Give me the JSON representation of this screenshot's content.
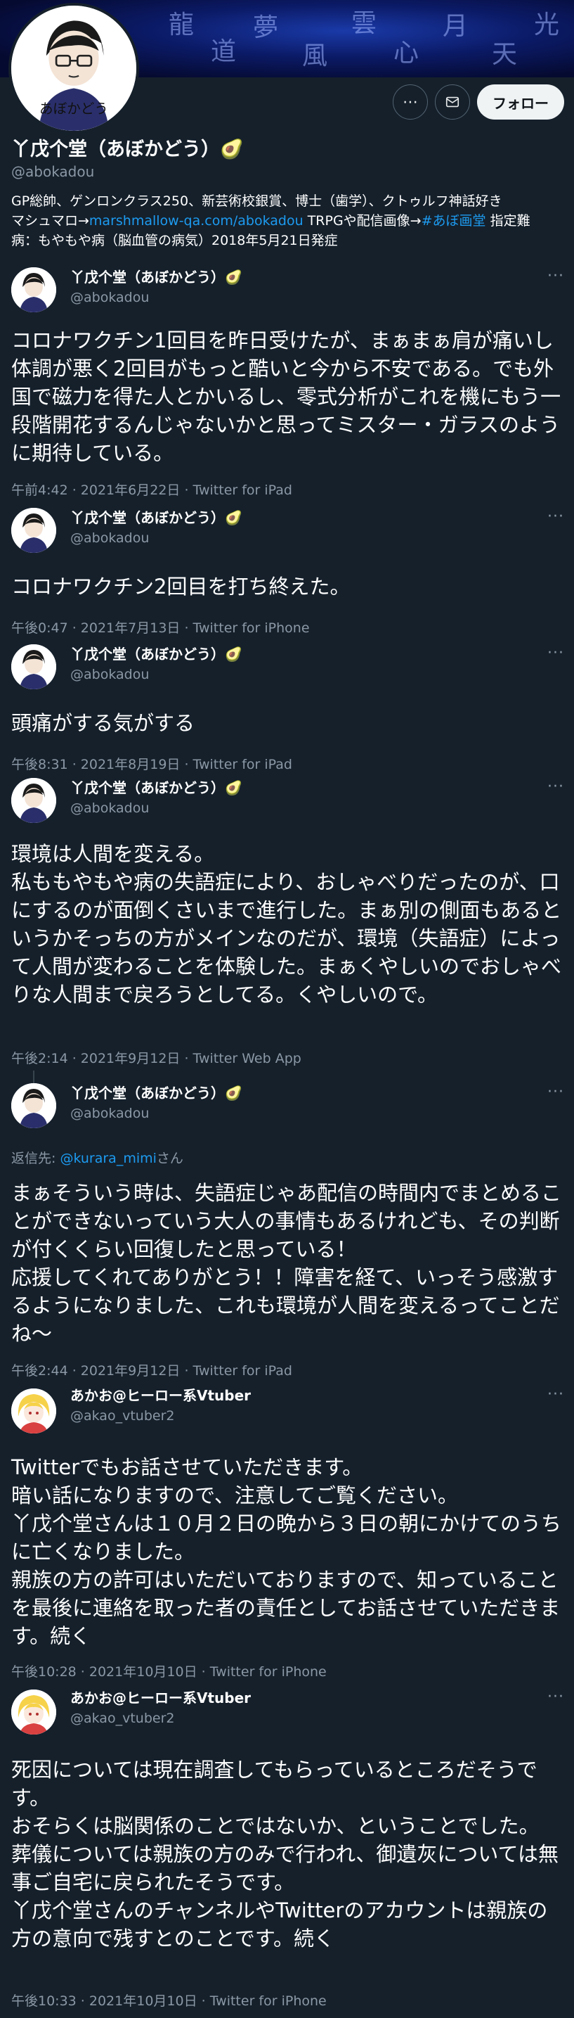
{
  "profile": {
    "display_name": "丫戊个堂（あぼかどう）🥑",
    "handle": "@abokadou",
    "bio_line1": "GP総帥、ゲンロンクラス250、新芸術校銀賞、博士（歯学）、クトゥルフ神話好き",
    "bio_line2_pre": "マシュマロ→",
    "bio_link1": "marshmallow-qa.com/abokadou",
    "bio_line2_mid": " TRPGや配信画像→",
    "bio_link2": "#あぼ画堂",
    "bio_line2_post": " 指定難",
    "bio_line3": "病：もやもや病（脳血管の病気）2018年5月21日発症",
    "avatar_text": "あぼかどう"
  },
  "actions": {
    "more_icon": "more-horizontal-icon",
    "message_icon": "mail-icon",
    "follow_label": "フォロー"
  },
  "tweets": [
    {
      "name": "丫戊个堂（あぼかどう）🥑",
      "handle": "@abokadou",
      "body": "コロナワクチン1回目を昨日受けたが、まぁまぁ肩が痛いし体調が悪く2回目がもっと酷いと今から不安である。でも外国で磁力を得た人とかいるし、零式分析がこれを機にもう一段階開花するんじゃないかと思ってミスター・ガラスのように期待している。",
      "meta": "午前4:42 · 2021年6月22日 · Twitter for iPad"
    },
    {
      "name": "丫戊个堂（あぼかどう）🥑",
      "handle": "@abokadou",
      "body": "コロナワクチン2回目を打ち終えた。",
      "meta": "午後0:47 · 2021年7月13日 · Twitter for iPhone"
    },
    {
      "name": "丫戊个堂（あぼかどう）🥑",
      "handle": "@abokadou",
      "body": "頭痛がする気がする",
      "meta": "午後8:31 · 2021年8月19日 · Twitter for iPad"
    },
    {
      "name": "丫戊个堂（あぼかどう）🥑",
      "handle": "@abokadou",
      "body": "環境は人間を変える。\n私ももやもや病の失語症により、おしゃべりだったのが、口にするのが面倒くさいまで進行した。まぁ別の側面もあるというかそっちの方がメインなのだが、環境（失語症）によって人間が変わることを体験した。まぁくやしいのでおしゃべりな人間まで戻ろうとしてる。くやしいので。",
      "meta": "午後2:14 · 2021年9月12日 · Twitter Web App"
    },
    {
      "name": "丫戊个堂（あぼかどう）🥑",
      "handle": "@abokadou",
      "reply_prefix": "返信先: ",
      "reply_mention": "@kurara_mimi",
      "reply_suffix": "さん",
      "body": "まぁそういう時は、失語症じゃあ配信の時間内でまとめることができないっていう大人の事情もあるけれども、その判断が付くくらい回復したと思っている！\n応援してくれてありがとう！！障害を経て、いっそう感激するようになりました、これも環境が人間を変えるってことだね〜",
      "meta": "午後2:44 · 2021年9月12日 · Twitter for iPad"
    },
    {
      "name": "あかお@ヒーロー系Vtuber",
      "handle": "@akao_vtuber2",
      "body": "Twitterでもお話させていただきます。\n暗い話になりますので、注意してご覧ください。\n丫戊个堂さんは１０月２日の晩から３日の朝にかけてのうちに亡くなりました。\n親族の方の許可はいただいておりますので、知っていることを最後に連絡を取った者の責任としてお話させていただきます。続く",
      "meta": "午後10:28 · 2021年10月10日 · Twitter for iPhone"
    },
    {
      "name": "あかお@ヒーロー系Vtuber",
      "handle": "@akao_vtuber2",
      "body": "死因については現在調査してもらっているところだそうです。\nおそらくは脳関係のことではないか、ということでした。\n葬儀については親族の方のみで行われ、御遺灰については無事ご自宅に戻られたそうです。\n丫戊个堂さんのチャンネルやTwitterのアカウントは親族の方の意向で残すとのことです。続く",
      "meta": "午後10:33 · 2021年10月10日 · Twitter for iPhone"
    }
  ],
  "colors": {
    "background": "#15202b",
    "text": "#ffffff",
    "muted": "#8b98a5",
    "link": "#1d9bf0",
    "follow_bg": "#eff3f4"
  }
}
